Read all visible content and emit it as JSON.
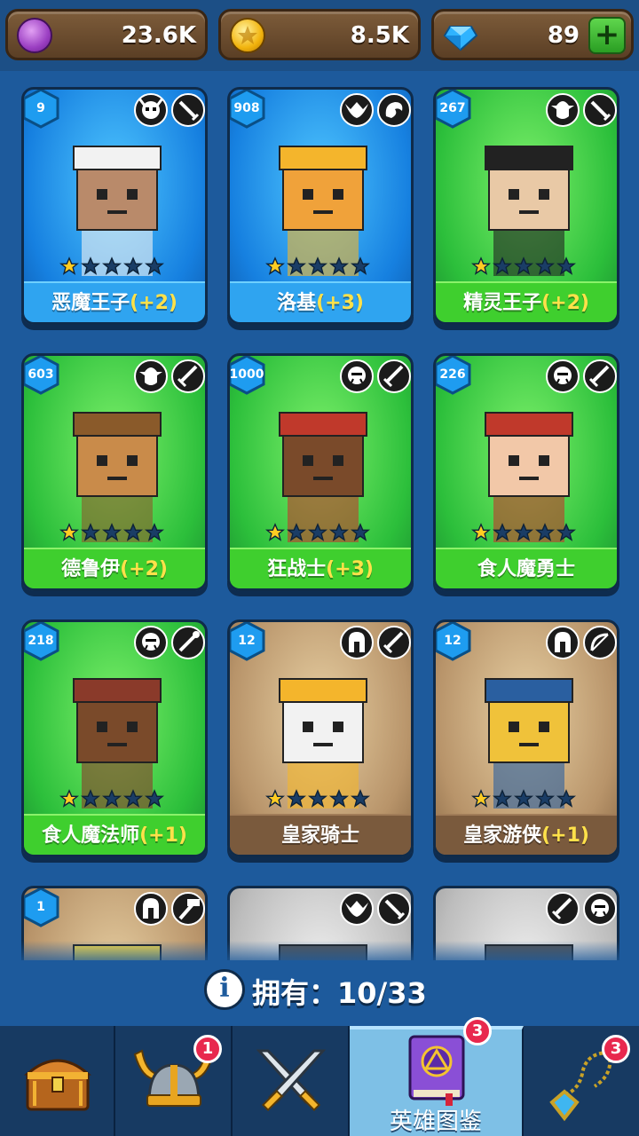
{
  "currencies": [
    {
      "name": "purple-coin",
      "value": "23.6K"
    },
    {
      "name": "gold-coin",
      "value": "8.5K"
    },
    {
      "name": "gem",
      "value": "89"
    }
  ],
  "heroes": [
    {
      "level": "9",
      "name": "恶魔王子",
      "bonus": "(+2)",
      "theme": "blue",
      "stars": 1,
      "class_icons": [
        "demon-skull-icon",
        "dagger-icon"
      ]
    },
    {
      "level": "908",
      "name": "洛基",
      "bonus": "(+3)",
      "theme": "blue",
      "stars": 1,
      "class_icons": [
        "winged-emblem-icon",
        "dragon-icon"
      ]
    },
    {
      "level": "267",
      "name": "精灵王子",
      "bonus": "(+2)",
      "theme": "green",
      "stars": 1,
      "class_icons": [
        "elf-icon",
        "dagger-icon"
      ]
    },
    {
      "level": "603",
      "name": "德鲁伊",
      "bonus": "(+2)",
      "theme": "green",
      "stars": 1,
      "class_icons": [
        "elf-icon",
        "sword-icon"
      ]
    },
    {
      "level": "1000",
      "name": "狂战士",
      "bonus": "(+3)",
      "theme": "green",
      "stars": 1,
      "class_icons": [
        "orc-icon",
        "sword-icon"
      ]
    },
    {
      "level": "226",
      "name": "食人魔勇士",
      "bonus": "",
      "theme": "green",
      "stars": 1,
      "class_icons": [
        "orc-icon",
        "sword-icon"
      ]
    },
    {
      "level": "218",
      "name": "食人魔法师",
      "bonus": "(+1)",
      "theme": "green",
      "stars": 1,
      "class_icons": [
        "orc-icon",
        "wand-icon"
      ]
    },
    {
      "level": "12",
      "name": "皇家骑士",
      "bonus": "",
      "theme": "brown",
      "stars": 1,
      "class_icons": [
        "helmet-icon",
        "sword-icon"
      ]
    },
    {
      "level": "12",
      "name": "皇家游侠",
      "bonus": "(+1)",
      "theme": "brown",
      "stars": 1,
      "class_icons": [
        "helmet-icon",
        "bow-icon"
      ]
    },
    {
      "level": "1",
      "name": "",
      "bonus": "",
      "theme": "brown",
      "stars": 0,
      "class_icons": [
        "helmet-icon",
        "hammer-icon"
      ]
    },
    {
      "level": "",
      "name": "",
      "bonus": "",
      "theme": "grey",
      "stars": 0,
      "class_icons": [
        "winged-emblem-icon",
        "dagger-icon"
      ]
    },
    {
      "level": "",
      "name": "",
      "bonus": "",
      "theme": "grey",
      "stars": 0,
      "class_icons": [
        "sword-icon",
        "orc-icon"
      ]
    }
  ],
  "owned": {
    "label": "拥有：",
    "value": "10/33"
  },
  "nav": {
    "tabs": [
      {
        "name": "chest",
        "label": "",
        "badge": ""
      },
      {
        "name": "helmet",
        "label": "",
        "badge": "1"
      },
      {
        "name": "battle",
        "label": "",
        "badge": ""
      },
      {
        "name": "hero-codex",
        "label": "英雄图鉴",
        "badge": "3",
        "active": true
      },
      {
        "name": "amulet",
        "label": "",
        "badge": "3"
      }
    ]
  }
}
